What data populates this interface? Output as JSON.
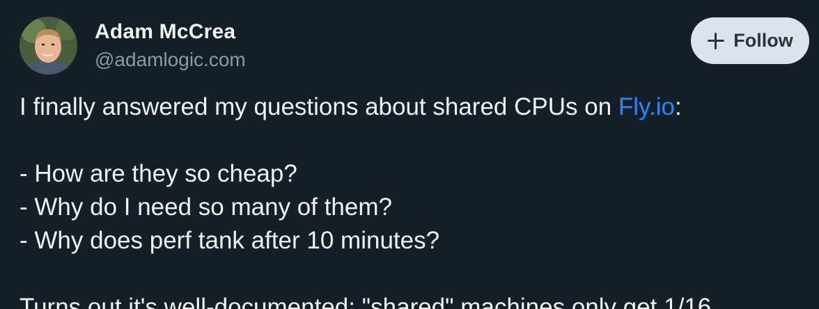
{
  "author": {
    "display_name": "Adam McCrea",
    "handle": "@adamlogic.com"
  },
  "follow_button": {
    "label": "Follow",
    "icon": "plus-icon"
  },
  "post": {
    "intro_before_link": "I finally answered my questions about shared CPUs on ",
    "link_text": "Fly.io",
    "intro_after_link": ":",
    "questions": [
      "- How are they so cheap?",
      "- Why do I need so many of them?",
      "- Why does perf tank after 10 minutes?"
    ],
    "conclusion_partial": "Turns out it's well-documented: \"shared\" machines only get 1/16"
  },
  "colors": {
    "background": "#161e27",
    "text": "#f1f3f5",
    "secondary_text": "#8c9aa9",
    "link": "#208bfe",
    "follow_button_bg": "#dde3ea"
  }
}
